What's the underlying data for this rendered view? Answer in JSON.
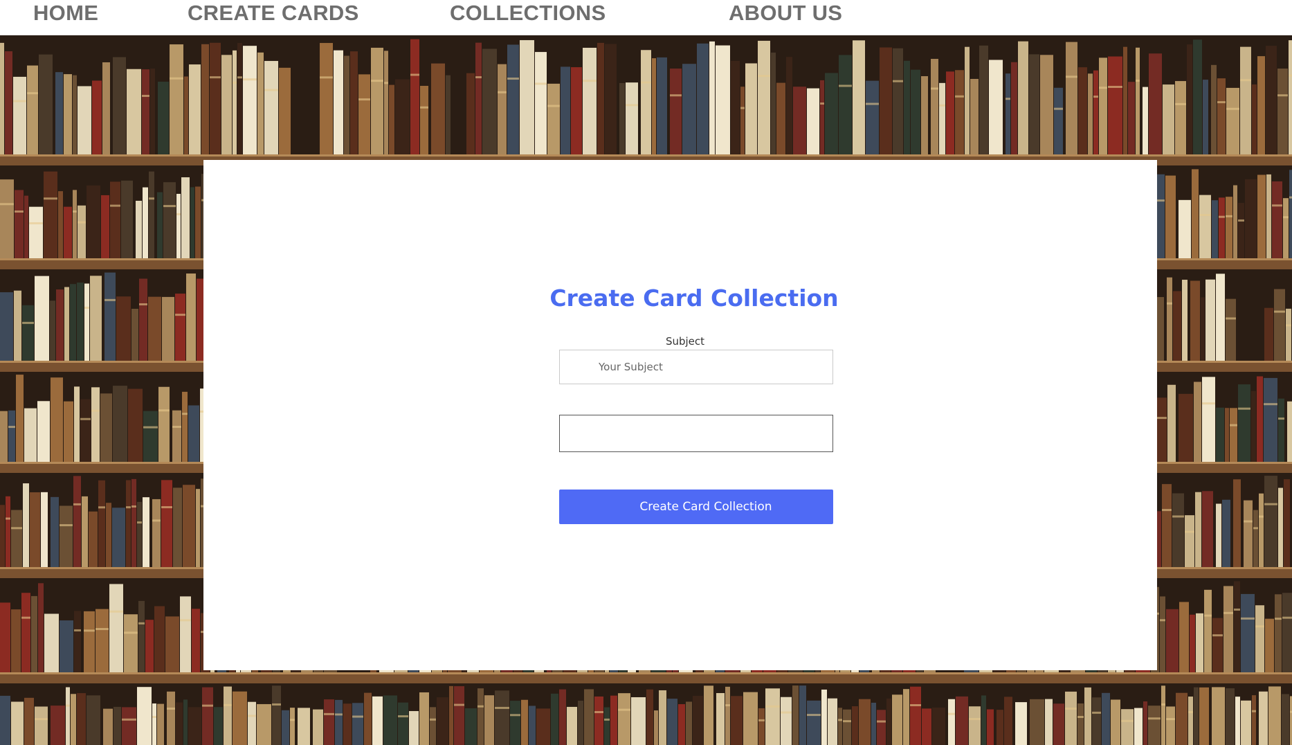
{
  "nav": {
    "items": [
      {
        "label": "HOME"
      },
      {
        "label": "CREATE CARDS"
      },
      {
        "label": "COLLECTIONS"
      },
      {
        "label": "ABOUT US"
      }
    ]
  },
  "form": {
    "title": "Create Card Collection",
    "subject_label": "Subject",
    "subject_placeholder": "Your Subject",
    "subject_value": "",
    "second_field_value": "",
    "submit_label": "Create Card Collection"
  },
  "colors": {
    "accent": "#4a6cf0",
    "button": "#4f6af5",
    "nav_text": "#6e6e6e",
    "background_image": "bookshelf"
  }
}
